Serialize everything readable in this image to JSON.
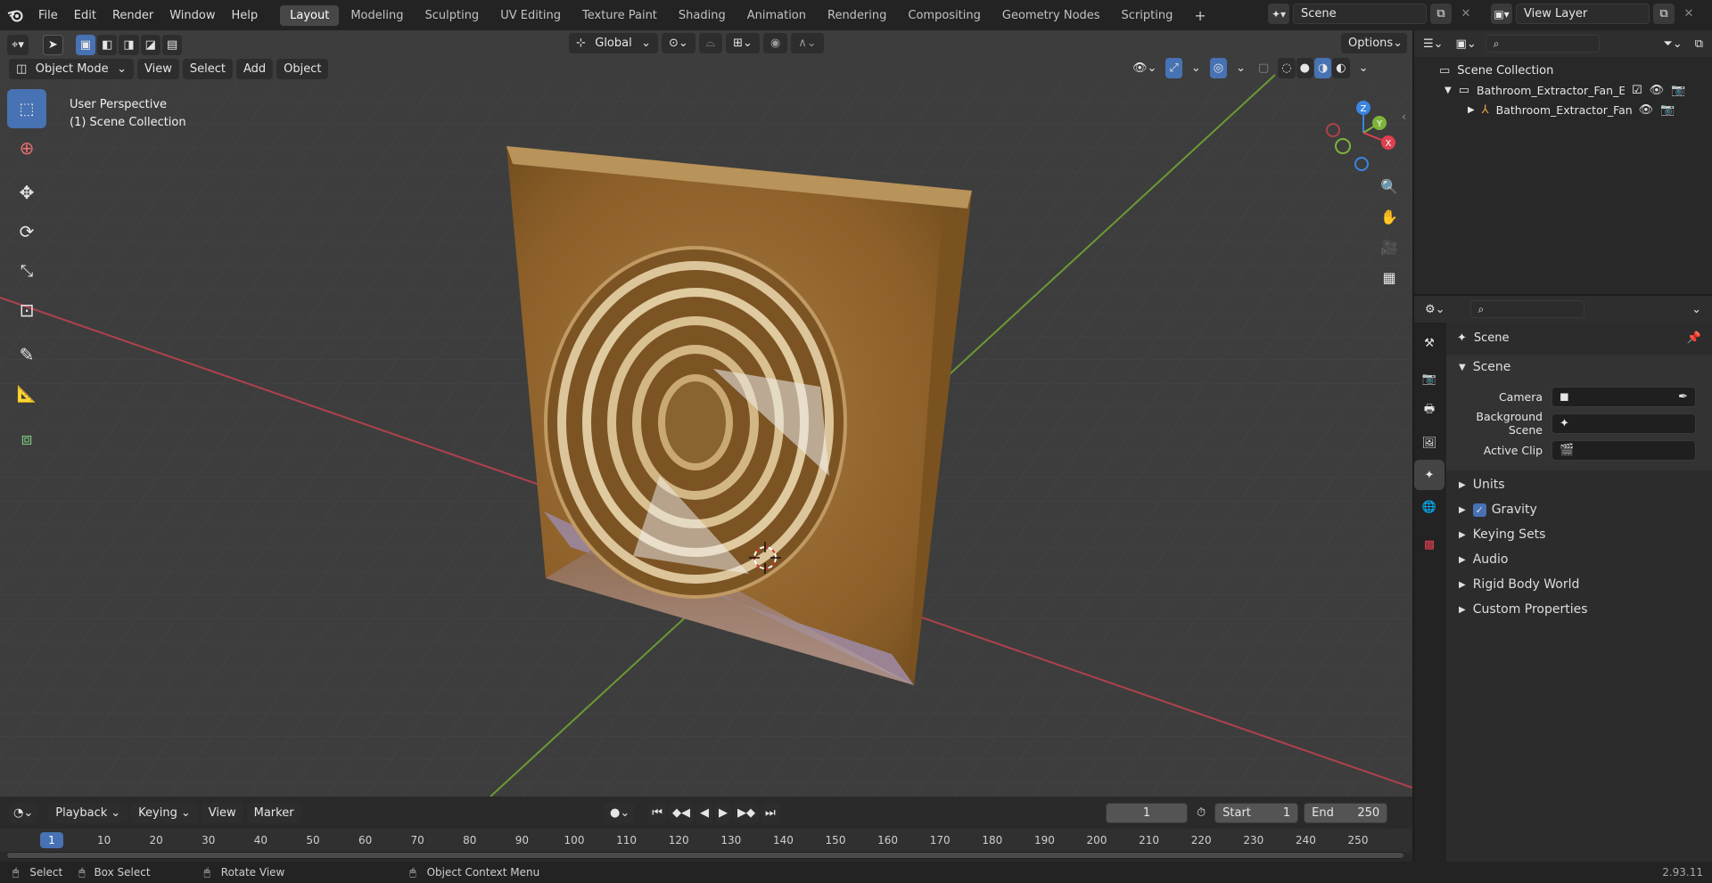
{
  "topbar": {
    "menus": [
      "File",
      "Edit",
      "Render",
      "Window",
      "Help"
    ],
    "workspaces": [
      "Layout",
      "Modeling",
      "Sculpting",
      "UV Editing",
      "Texture Paint",
      "Shading",
      "Animation",
      "Rendering",
      "Compositing",
      "Geometry Nodes",
      "Scripting"
    ],
    "active_workspace": "Layout",
    "add_label": "+",
    "scene_name": "Scene",
    "view_layer_name": "View Layer"
  },
  "viewport_header": {
    "transform_orientation": "Global",
    "options_label": "Options",
    "mode": "Object Mode",
    "menus": [
      "View",
      "Select",
      "Add",
      "Object"
    ]
  },
  "viewport": {
    "perspective_label": "User Perspective",
    "collection_label": "(1) Scene Collection",
    "gizmo_axes": {
      "x": "X",
      "y": "Y",
      "z": "Z"
    }
  },
  "timeline": {
    "menus": [
      "Playback",
      "Keying",
      "View",
      "Marker"
    ],
    "current_frame": "1",
    "start_label": "Start",
    "start_value": "1",
    "end_label": "End",
    "end_value": "250",
    "ruler": [
      "1",
      "10",
      "20",
      "30",
      "40",
      "50",
      "60",
      "70",
      "80",
      "90",
      "100",
      "110",
      "120",
      "130",
      "140",
      "150",
      "160",
      "170",
      "180",
      "190",
      "200",
      "210",
      "220",
      "230",
      "240",
      "250"
    ]
  },
  "statusbar": {
    "select": "Select",
    "box_select": "Box Select",
    "rotate_view": "Rotate View",
    "context_menu": "Object Context Menu",
    "version": "2.93.11"
  },
  "outliner": {
    "root": "Scene Collection",
    "items": [
      {
        "label": "Bathroom_Extractor_Fan_Env"
      },
      {
        "label": "Bathroom_Extractor_Fan"
      }
    ]
  },
  "properties": {
    "context_title": "Scene",
    "panel_title": "Scene",
    "fields": [
      {
        "label": "Camera",
        "value": ""
      },
      {
        "label": "Background Scene",
        "value": ""
      },
      {
        "label": "Active Clip",
        "value": ""
      }
    ],
    "sections": [
      "Units",
      "Gravity",
      "Keying Sets",
      "Audio",
      "Rigid Body World",
      "Custom Properties"
    ],
    "gravity_checked": true
  },
  "colors": {
    "accent": "#4772b3",
    "x_axis": "#e04050",
    "y_axis": "#7fb33a",
    "z_axis": "#3a86e0",
    "fan_body": "#9a6a2c"
  }
}
